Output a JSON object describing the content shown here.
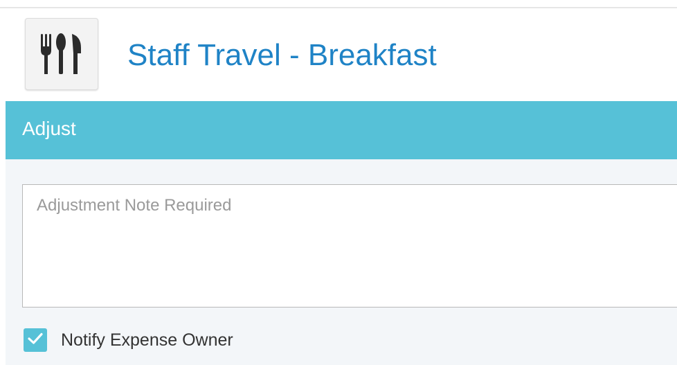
{
  "header": {
    "title": "Staff Travel - Breakfast",
    "icon": "utensils-icon",
    "title_color": "#1f83c6"
  },
  "section": {
    "title": "Adjust",
    "bar_color": "#56c1d7"
  },
  "adjustment_note": {
    "value": "",
    "placeholder": "Adjustment Note Required"
  },
  "notify": {
    "label": "Notify Expense Owner",
    "checked": true,
    "icon": "checkmark-icon"
  }
}
